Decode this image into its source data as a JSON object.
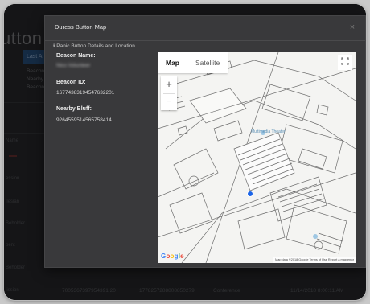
{
  "background": {
    "title_fragment": "utton D",
    "tab_label": "Last Al",
    "lines": [
      "Beacon",
      "Nearby",
      "Beacon"
    ],
    "row_labels": [
      "Name",
      "ession",
      "llesian",
      "Beholder",
      "bent",
      "Beholder",
      "lission"
    ],
    "footer_row": [
      "7005367397954391 20",
      "1778257288808850279",
      "Conference",
      "11/14/2018 8:00:11 AM"
    ]
  },
  "modal": {
    "title": "Duress Button Map",
    "close_glyph": "×",
    "section_title": "Panic Button Details and Location",
    "beacon_name_label": "Beacon Name:",
    "beacon_name_value": "Nico Volunteer",
    "beacon_id_label": "Beacon ID:",
    "beacon_id_value": "16774383194547632201",
    "nearby_label": "Nearby Bluff:",
    "nearby_value": "9264559514565758414"
  },
  "map": {
    "type_map": "Map",
    "type_satellite": "Satellite",
    "zoom_in": "+",
    "zoom_out": "−",
    "fullscreen_icon": "fullscreen-icon",
    "logo_letters": [
      "G",
      "o",
      "o",
      "g",
      "l",
      "e"
    ],
    "attribution": "Map data ©2018 Google   Terms of Use   Report a map error",
    "place_label": "Multimedia Theater",
    "accent_marker": "#1a64e8"
  }
}
